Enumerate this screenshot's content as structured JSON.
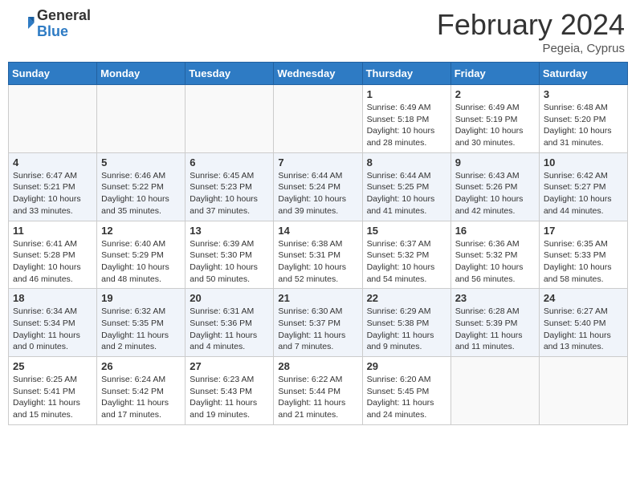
{
  "header": {
    "logo_general": "General",
    "logo_blue": "Blue",
    "month_title": "February 2024",
    "location": "Pegeia, Cyprus"
  },
  "weekdays": [
    "Sunday",
    "Monday",
    "Tuesday",
    "Wednesday",
    "Thursday",
    "Friday",
    "Saturday"
  ],
  "weeks": [
    [
      {
        "day": "",
        "info": ""
      },
      {
        "day": "",
        "info": ""
      },
      {
        "day": "",
        "info": ""
      },
      {
        "day": "",
        "info": ""
      },
      {
        "day": "1",
        "info": "Sunrise: 6:49 AM\nSunset: 5:18 PM\nDaylight: 10 hours and 28 minutes."
      },
      {
        "day": "2",
        "info": "Sunrise: 6:49 AM\nSunset: 5:19 PM\nDaylight: 10 hours and 30 minutes."
      },
      {
        "day": "3",
        "info": "Sunrise: 6:48 AM\nSunset: 5:20 PM\nDaylight: 10 hours and 31 minutes."
      }
    ],
    [
      {
        "day": "4",
        "info": "Sunrise: 6:47 AM\nSunset: 5:21 PM\nDaylight: 10 hours and 33 minutes."
      },
      {
        "day": "5",
        "info": "Sunrise: 6:46 AM\nSunset: 5:22 PM\nDaylight: 10 hours and 35 minutes."
      },
      {
        "day": "6",
        "info": "Sunrise: 6:45 AM\nSunset: 5:23 PM\nDaylight: 10 hours and 37 minutes."
      },
      {
        "day": "7",
        "info": "Sunrise: 6:44 AM\nSunset: 5:24 PM\nDaylight: 10 hours and 39 minutes."
      },
      {
        "day": "8",
        "info": "Sunrise: 6:44 AM\nSunset: 5:25 PM\nDaylight: 10 hours and 41 minutes."
      },
      {
        "day": "9",
        "info": "Sunrise: 6:43 AM\nSunset: 5:26 PM\nDaylight: 10 hours and 42 minutes."
      },
      {
        "day": "10",
        "info": "Sunrise: 6:42 AM\nSunset: 5:27 PM\nDaylight: 10 hours and 44 minutes."
      }
    ],
    [
      {
        "day": "11",
        "info": "Sunrise: 6:41 AM\nSunset: 5:28 PM\nDaylight: 10 hours and 46 minutes."
      },
      {
        "day": "12",
        "info": "Sunrise: 6:40 AM\nSunset: 5:29 PM\nDaylight: 10 hours and 48 minutes."
      },
      {
        "day": "13",
        "info": "Sunrise: 6:39 AM\nSunset: 5:30 PM\nDaylight: 10 hours and 50 minutes."
      },
      {
        "day": "14",
        "info": "Sunrise: 6:38 AM\nSunset: 5:31 PM\nDaylight: 10 hours and 52 minutes."
      },
      {
        "day": "15",
        "info": "Sunrise: 6:37 AM\nSunset: 5:32 PM\nDaylight: 10 hours and 54 minutes."
      },
      {
        "day": "16",
        "info": "Sunrise: 6:36 AM\nSunset: 5:32 PM\nDaylight: 10 hours and 56 minutes."
      },
      {
        "day": "17",
        "info": "Sunrise: 6:35 AM\nSunset: 5:33 PM\nDaylight: 10 hours and 58 minutes."
      }
    ],
    [
      {
        "day": "18",
        "info": "Sunrise: 6:34 AM\nSunset: 5:34 PM\nDaylight: 11 hours and 0 minutes."
      },
      {
        "day": "19",
        "info": "Sunrise: 6:32 AM\nSunset: 5:35 PM\nDaylight: 11 hours and 2 minutes."
      },
      {
        "day": "20",
        "info": "Sunrise: 6:31 AM\nSunset: 5:36 PM\nDaylight: 11 hours and 4 minutes."
      },
      {
        "day": "21",
        "info": "Sunrise: 6:30 AM\nSunset: 5:37 PM\nDaylight: 11 hours and 7 minutes."
      },
      {
        "day": "22",
        "info": "Sunrise: 6:29 AM\nSunset: 5:38 PM\nDaylight: 11 hours and 9 minutes."
      },
      {
        "day": "23",
        "info": "Sunrise: 6:28 AM\nSunset: 5:39 PM\nDaylight: 11 hours and 11 minutes."
      },
      {
        "day": "24",
        "info": "Sunrise: 6:27 AM\nSunset: 5:40 PM\nDaylight: 11 hours and 13 minutes."
      }
    ],
    [
      {
        "day": "25",
        "info": "Sunrise: 6:25 AM\nSunset: 5:41 PM\nDaylight: 11 hours and 15 minutes."
      },
      {
        "day": "26",
        "info": "Sunrise: 6:24 AM\nSunset: 5:42 PM\nDaylight: 11 hours and 17 minutes."
      },
      {
        "day": "27",
        "info": "Sunrise: 6:23 AM\nSunset: 5:43 PM\nDaylight: 11 hours and 19 minutes."
      },
      {
        "day": "28",
        "info": "Sunrise: 6:22 AM\nSunset: 5:44 PM\nDaylight: 11 hours and 21 minutes."
      },
      {
        "day": "29",
        "info": "Sunrise: 6:20 AM\nSunset: 5:45 PM\nDaylight: 11 hours and 24 minutes."
      },
      {
        "day": "",
        "info": ""
      },
      {
        "day": "",
        "info": ""
      }
    ]
  ]
}
